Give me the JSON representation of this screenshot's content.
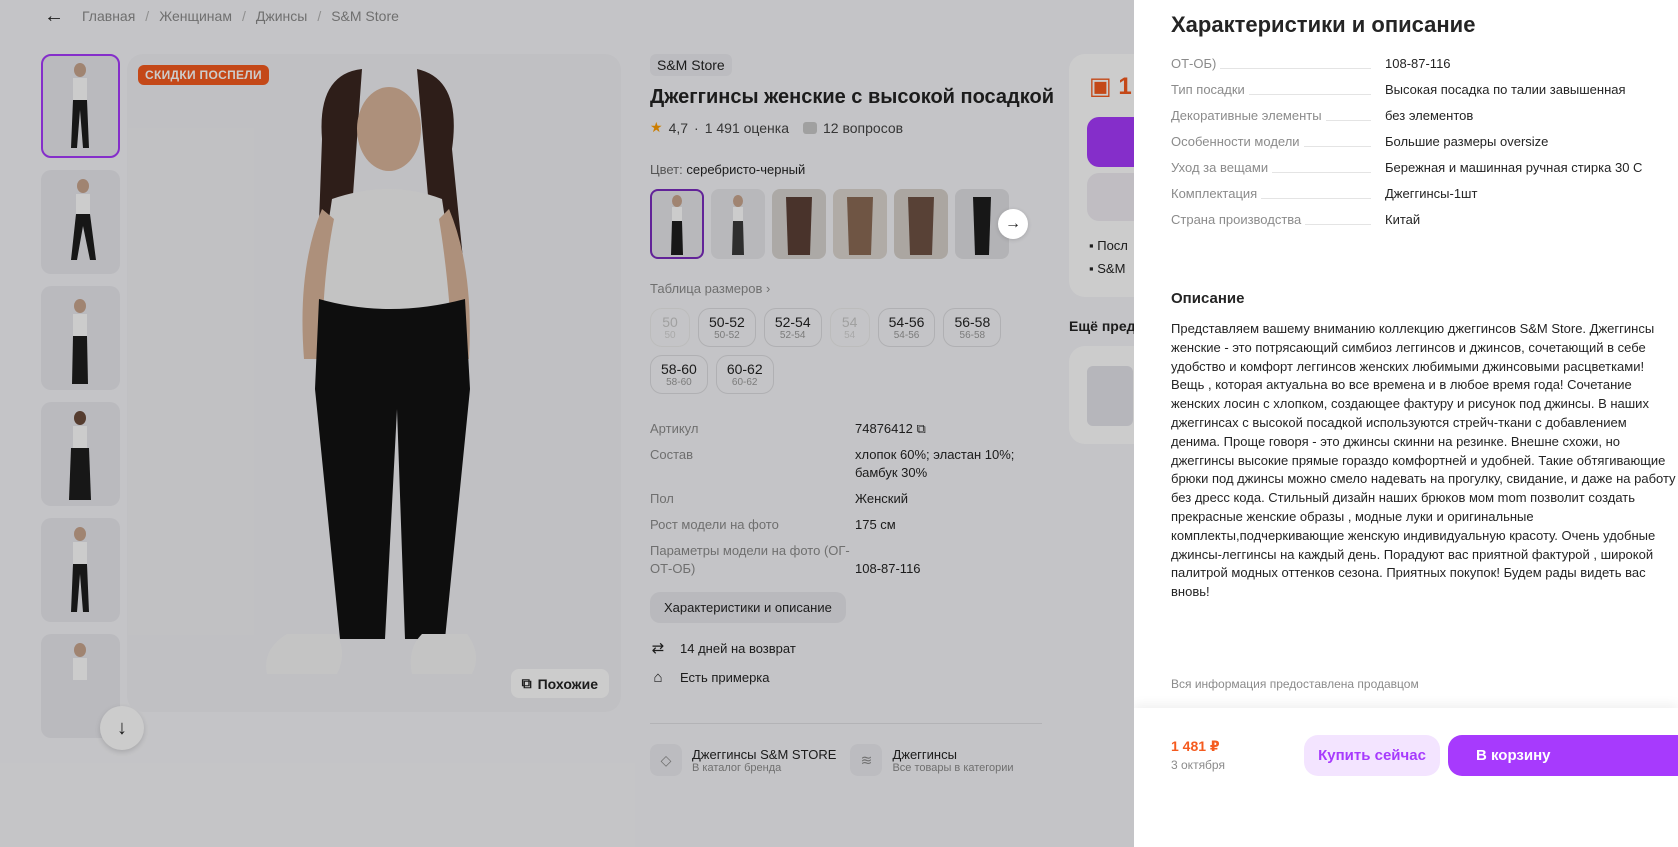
{
  "breadcrumb": {
    "items": [
      "Главная",
      "Женщинам",
      "Джинсы",
      "S&M Store"
    ]
  },
  "gallery": {
    "badge": "СКИДКИ ПОСПЕЛИ",
    "similar_label": "Похожие"
  },
  "product": {
    "brand": "S&M Store",
    "title": "Джеггинсы женские с высокой посадкой",
    "rating": "4,7",
    "reviews": "1 491 оценка",
    "questions": "12 вопросов",
    "color_label": "Цвет:",
    "color_value": "серебристо-черный",
    "size_table": "Таблица размеров",
    "sizes": [
      {
        "a": "50",
        "b": "50",
        "disabled": true
      },
      {
        "a": "50-52",
        "b": "50-52"
      },
      {
        "a": "52-54",
        "b": "52-54"
      },
      {
        "a": "54",
        "b": "54",
        "disabled": true
      },
      {
        "a": "54-56",
        "b": "54-56"
      },
      {
        "a": "56-58",
        "b": "56-58"
      },
      {
        "a": "58-60",
        "b": "58-60"
      },
      {
        "a": "60-62",
        "b": "60-62"
      }
    ],
    "specs": [
      {
        "k": "Артикул",
        "v": "74876412"
      },
      {
        "k": "Состав",
        "v": "хлопок 60%; эластан 10%; бамбук 30%"
      },
      {
        "k": "Пол",
        "v": "Женский"
      },
      {
        "k": "Рост модели на фото",
        "v": "175 см"
      },
      {
        "k": "Параметры модели на фото (ОГ-ОТ-ОБ)",
        "v": "108-87-116"
      }
    ],
    "chars_button": "Характеристики и описание",
    "return": "14 дней на возврат",
    "fitting": "Есть примерка",
    "link1_title": "Джеггинсы S&M STORE",
    "link1_sub": "В каталог бренда",
    "link2_title": "Джеггинсы",
    "link2_sub": "Все товары в категории"
  },
  "buybox": {
    "price_partial": "1",
    "line1": "Посл",
    "line2": "S&M"
  },
  "more_title": "Ещё пред",
  "panel": {
    "title": "Характеристики и описание",
    "rows": [
      {
        "k": "ОТ-ОБ)",
        "v": "108-87-116"
      },
      {
        "k": "Тип посадки",
        "v": "Высокая посадка по талии завышенная"
      },
      {
        "k": "Декоративные элементы",
        "v": "без элементов"
      },
      {
        "k": "Особенности модели",
        "v": "Большие размеры oversize"
      },
      {
        "k": "Уход за вещами",
        "v": "Бережная и машинная ручная стирка 30 С"
      },
      {
        "k": "Комплектация",
        "v": "Джеггинсы-1шт"
      },
      {
        "k": "Страна производства",
        "v": "Китай"
      }
    ],
    "desc_title": "Описание",
    "desc": "Представляем вашему вниманию коллекцию джеггинсов S&M Store. Джеггинсы женские - это потрясающий симбиоз леггинсов и джинсов, сочетающий в себе удобство и комфорт леггинсов женских любимыми джинсовыми расцветками! Вещь , которая актуальна во все времена и в любое время года! Сочетание женских лосин с хлопком, создающее фактуру и рисунок под джинсы. В наших джеггинсах с высокой посадкой используются стрейч-ткани с добавлением денима. Проще говоря - это джинсы скинни на резинке. Внешне схожи, но джеггинсы высокие прямые гораздо комфортней и удобней. Такие обтягивающие брюки под джинсы можно смело надевать на прогулку, свидание, и даже на работу без дресс кода. Стильный дизайн наших брюков мом mom позволит создать прекрасные женские образы , модные луки и оригинальные комплекты,подчеркивающие женскую индивидуальную красоту. Очень удобные джинсы-леггинсы на каждый день. Порадуют вас приятной фактурой , широкой палитрой модных оттенков сезона. Приятных покупок! Будем рады видеть вас вновь!",
    "note": "Вся информация предоставлена продавцом",
    "price": "1 481 ₽",
    "date": "3 октября",
    "buy_now": "Купить сейчас",
    "to_cart": "В корзину"
  }
}
